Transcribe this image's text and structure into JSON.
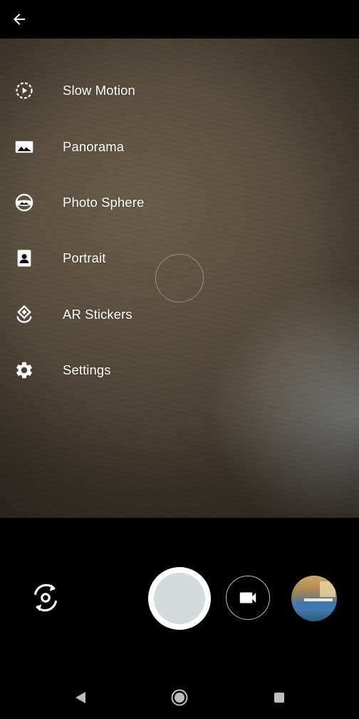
{
  "top_bar": {
    "back_icon": "arrow-left-icon"
  },
  "menu": {
    "items": [
      {
        "label": "Slow Motion",
        "icon": "slow-motion-icon"
      },
      {
        "label": "Panorama",
        "icon": "panorama-icon"
      },
      {
        "label": "Photo Sphere",
        "icon": "photo-sphere-icon"
      },
      {
        "label": "Portrait",
        "icon": "portrait-icon"
      },
      {
        "label": "AR Stickers",
        "icon": "ar-stickers-icon"
      },
      {
        "label": "Settings",
        "icon": "gear-icon"
      }
    ]
  },
  "controls": {
    "switch_camera_icon": "switch-camera-icon",
    "shutter_icon": "shutter-button",
    "video_icon": "video-camera-icon",
    "gallery_icon": "gallery-thumbnail"
  },
  "navbar": {
    "back_icon": "nav-back-icon",
    "home_icon": "nav-home-icon",
    "recents_icon": "nav-recents-icon"
  },
  "colors": {
    "background": "#000000",
    "shutter_inner": "#d5dadd",
    "text": "#ffffff"
  }
}
